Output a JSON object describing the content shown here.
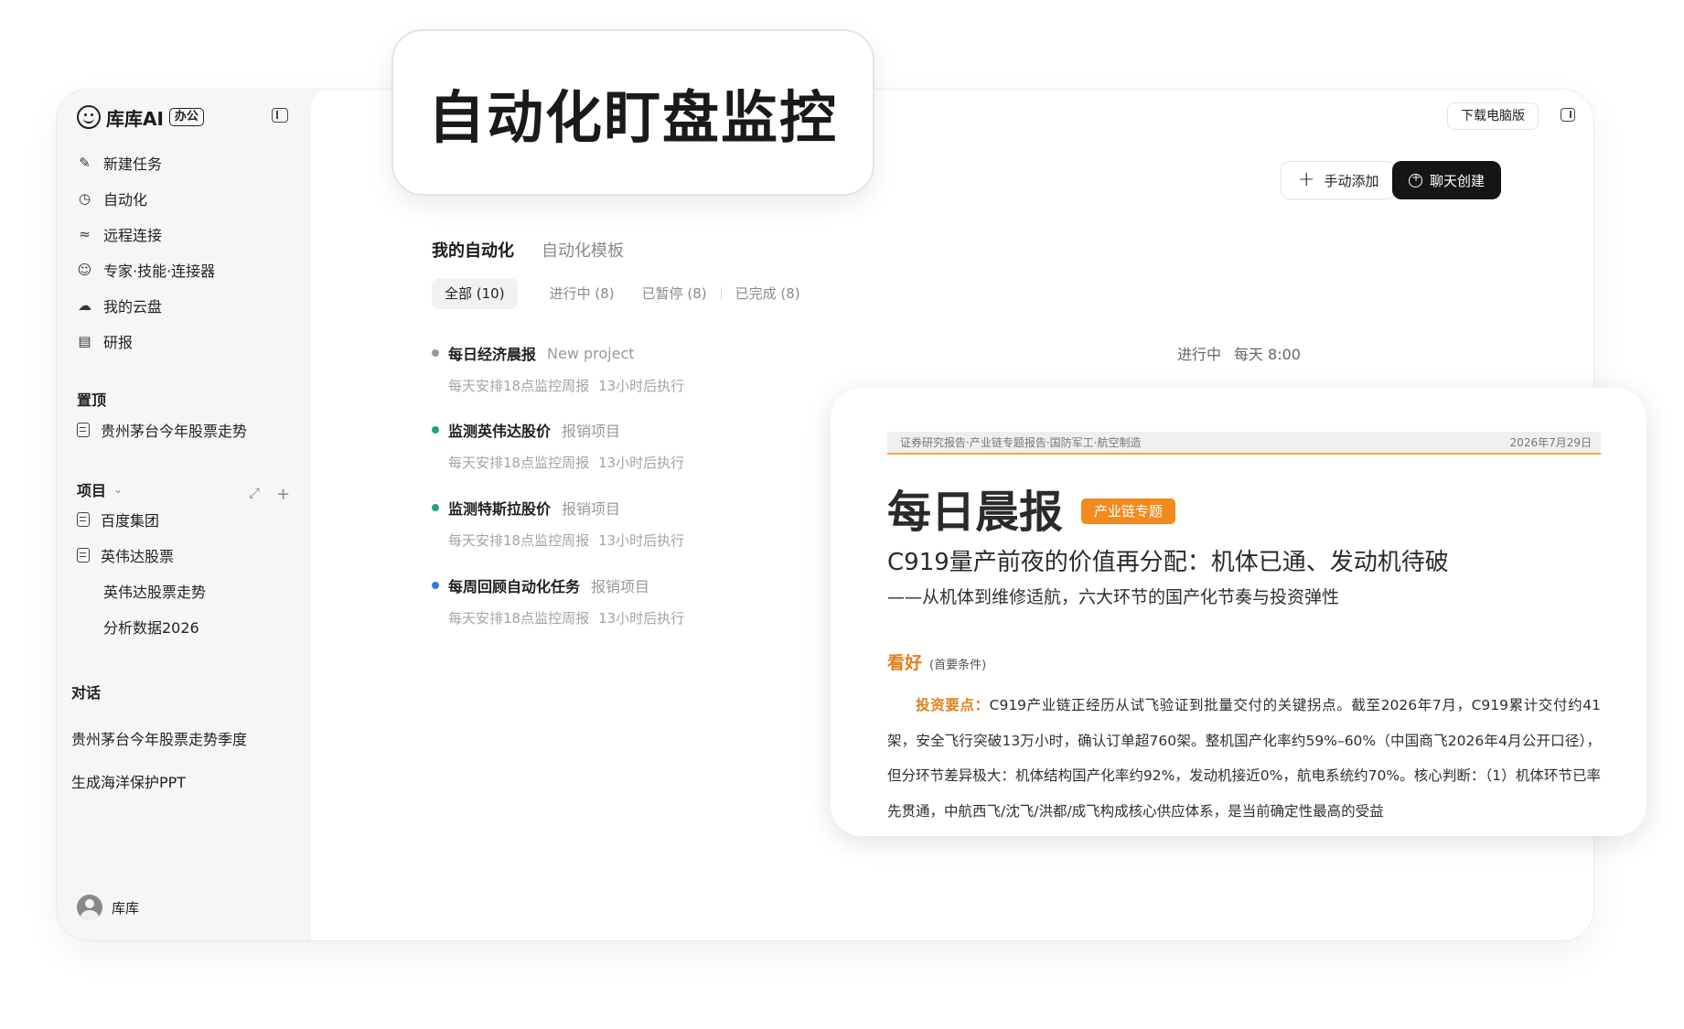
{
  "app": {
    "name": "库库AI",
    "tag": "办公"
  },
  "nav": [
    {
      "label": "新建任务",
      "icon": "edit-icon"
    },
    {
      "label": "自动化",
      "icon": "clock-icon"
    },
    {
      "label": "远程连接",
      "icon": "route-icon"
    },
    {
      "label": "专家·技能·连接器",
      "icon": "smile-icon"
    },
    {
      "label": "我的云盘",
      "icon": "cloud-icon"
    },
    {
      "label": "研报",
      "icon": "report-icon"
    }
  ],
  "pinned": {
    "title": "置顶",
    "items": [
      "贵州茅台今年股票走势"
    ]
  },
  "projects": {
    "title": "项目",
    "items": [
      {
        "label": "百度集团",
        "icon": true
      },
      {
        "label": "英伟达股票",
        "icon": true
      },
      {
        "label": "英伟达股票走势",
        "icon": false
      },
      {
        "label": "分析数据2026",
        "icon": false
      }
    ]
  },
  "chats": {
    "title": "对话",
    "items": [
      "贵州茅台今年股票走势季度",
      "生成海洋保护PPT"
    ]
  },
  "user": {
    "name": "库库"
  },
  "header": {
    "download": "下载电脑版",
    "manual_add": "手动添加",
    "chat_create": "聊天创建"
  },
  "tabs": {
    "mine": "我的自动化",
    "templates": "自动化模板"
  },
  "filters": {
    "all": "全部 (10)",
    "running": "进行中 (8)",
    "paused": "已暂停 (8)",
    "done": "已完成 (8)"
  },
  "tasks": [
    {
      "name": "每日经济晨报",
      "project": "New project",
      "schedule": "每天安排18点监控周报",
      "next": "13小时后执行",
      "dot": "#999999",
      "status": "进行中",
      "time": "每天 8:00"
    },
    {
      "name": "监测英伟达股价",
      "project": "报销项目",
      "schedule": "每天安排18点监控周报",
      "next": "13小时后执行",
      "dot": "#1aa87a"
    },
    {
      "name": "监测特斯拉股价",
      "project": "报销项目",
      "schedule": "每天安排18点监控周报",
      "next": "13小时后执行",
      "dot": "#1aa87a"
    },
    {
      "name": "每周回顾自动化任务",
      "project": "报销项目",
      "schedule": "每天安排18点监控周报",
      "next": "13小时后执行",
      "dot": "#2a7de1"
    }
  ],
  "feature_title": "自动化盯盘监控",
  "report": {
    "category": "证券研究报告·产业链专题报告·国防军工·航空制造",
    "date": "2026年7月29日",
    "title": "每日晨报",
    "badge": "产业链专题",
    "headline": "C919量产前夜的价值再分配：机体已通、发动机待破",
    "subhead": "——从机体到维修适航，六大环节的国产化节奏与投资弹性",
    "view": "看好",
    "view_note": "(首要条件)",
    "key_label": "投资要点：",
    "body": "C919产业链正经历从试飞验证到批量交付的关键拐点。截至2026年7月，C919累计交付约41架，安全飞行突破13万小时，确认订单超760架。整机国产化率约59%–60%（中国商飞2026年4月公开口径），但分环节差异极大：机体结构国产化率约92%，发动机接近0%，航电系统约70%。核心判断：（1）机体环节已率先贯通，中航西飞/沈飞/洪都/成飞构成核心供应体系，是当前确定性最高的受益"
  }
}
